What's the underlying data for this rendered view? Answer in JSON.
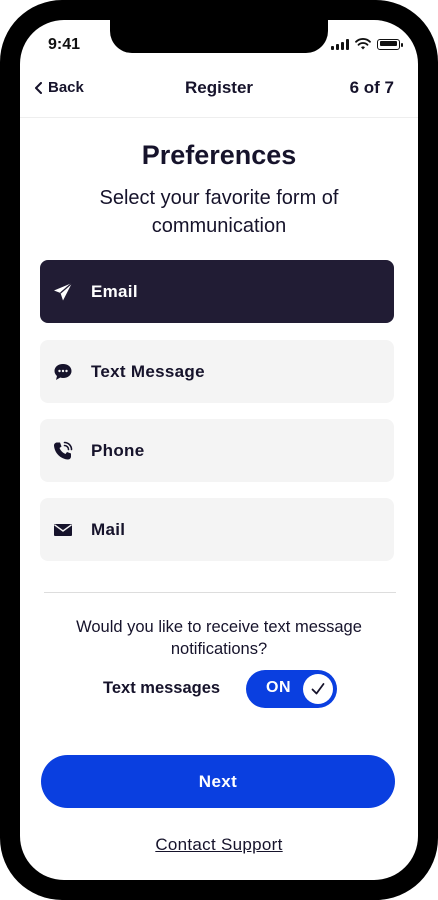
{
  "status_bar": {
    "time": "9:41"
  },
  "nav": {
    "back_label": "Back",
    "title": "Register",
    "step": "6 of 7"
  },
  "page": {
    "title": "Preferences",
    "subtitle": "Select your favorite form of communication"
  },
  "options": [
    {
      "label": "Email",
      "icon": "paper-plane-icon",
      "selected": true
    },
    {
      "label": "Text Message",
      "icon": "chat-bubble-icon",
      "selected": false
    },
    {
      "label": "Phone",
      "icon": "phone-icon",
      "selected": false
    },
    {
      "label": "Mail",
      "icon": "envelope-icon",
      "selected": false
    }
  ],
  "notifications": {
    "question": "Would you like to receive text message notifications?",
    "toggle_label": "Text messages",
    "toggle_state": "ON"
  },
  "actions": {
    "next_label": "Next",
    "support_label": "Contact Support"
  },
  "colors": {
    "primary": "#0a3fe0",
    "selected_option": "#211c34",
    "text": "#16132b",
    "option_bg": "#f4f4f4"
  }
}
